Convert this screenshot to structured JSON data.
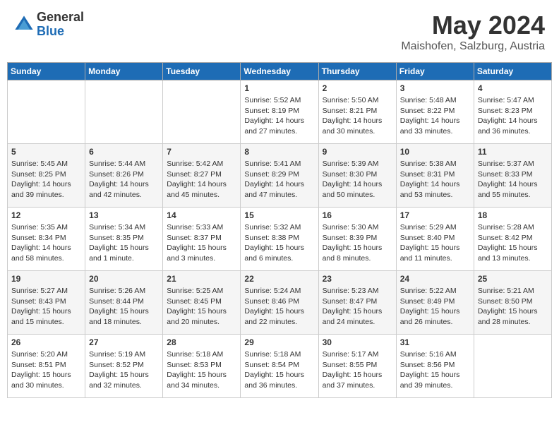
{
  "header": {
    "logo_general": "General",
    "logo_blue": "Blue",
    "month_title": "May 2024",
    "subtitle": "Maishofen, Salzburg, Austria"
  },
  "weekdays": [
    "Sunday",
    "Monday",
    "Tuesday",
    "Wednesday",
    "Thursday",
    "Friday",
    "Saturday"
  ],
  "weeks": [
    [
      {
        "day": "",
        "sunrise": "",
        "sunset": "",
        "daylight": ""
      },
      {
        "day": "",
        "sunrise": "",
        "sunset": "",
        "daylight": ""
      },
      {
        "day": "",
        "sunrise": "",
        "sunset": "",
        "daylight": ""
      },
      {
        "day": "1",
        "sunrise": "Sunrise: 5:52 AM",
        "sunset": "Sunset: 8:19 PM",
        "daylight": "Daylight: 14 hours and 27 minutes."
      },
      {
        "day": "2",
        "sunrise": "Sunrise: 5:50 AM",
        "sunset": "Sunset: 8:21 PM",
        "daylight": "Daylight: 14 hours and 30 minutes."
      },
      {
        "day": "3",
        "sunrise": "Sunrise: 5:48 AM",
        "sunset": "Sunset: 8:22 PM",
        "daylight": "Daylight: 14 hours and 33 minutes."
      },
      {
        "day": "4",
        "sunrise": "Sunrise: 5:47 AM",
        "sunset": "Sunset: 8:23 PM",
        "daylight": "Daylight: 14 hours and 36 minutes."
      }
    ],
    [
      {
        "day": "5",
        "sunrise": "Sunrise: 5:45 AM",
        "sunset": "Sunset: 8:25 PM",
        "daylight": "Daylight: 14 hours and 39 minutes."
      },
      {
        "day": "6",
        "sunrise": "Sunrise: 5:44 AM",
        "sunset": "Sunset: 8:26 PM",
        "daylight": "Daylight: 14 hours and 42 minutes."
      },
      {
        "day": "7",
        "sunrise": "Sunrise: 5:42 AM",
        "sunset": "Sunset: 8:27 PM",
        "daylight": "Daylight: 14 hours and 45 minutes."
      },
      {
        "day": "8",
        "sunrise": "Sunrise: 5:41 AM",
        "sunset": "Sunset: 8:29 PM",
        "daylight": "Daylight: 14 hours and 47 minutes."
      },
      {
        "day": "9",
        "sunrise": "Sunrise: 5:39 AM",
        "sunset": "Sunset: 8:30 PM",
        "daylight": "Daylight: 14 hours and 50 minutes."
      },
      {
        "day": "10",
        "sunrise": "Sunrise: 5:38 AM",
        "sunset": "Sunset: 8:31 PM",
        "daylight": "Daylight: 14 hours and 53 minutes."
      },
      {
        "day": "11",
        "sunrise": "Sunrise: 5:37 AM",
        "sunset": "Sunset: 8:33 PM",
        "daylight": "Daylight: 14 hours and 55 minutes."
      }
    ],
    [
      {
        "day": "12",
        "sunrise": "Sunrise: 5:35 AM",
        "sunset": "Sunset: 8:34 PM",
        "daylight": "Daylight: 14 hours and 58 minutes."
      },
      {
        "day": "13",
        "sunrise": "Sunrise: 5:34 AM",
        "sunset": "Sunset: 8:35 PM",
        "daylight": "Daylight: 15 hours and 1 minute."
      },
      {
        "day": "14",
        "sunrise": "Sunrise: 5:33 AM",
        "sunset": "Sunset: 8:37 PM",
        "daylight": "Daylight: 15 hours and 3 minutes."
      },
      {
        "day": "15",
        "sunrise": "Sunrise: 5:32 AM",
        "sunset": "Sunset: 8:38 PM",
        "daylight": "Daylight: 15 hours and 6 minutes."
      },
      {
        "day": "16",
        "sunrise": "Sunrise: 5:30 AM",
        "sunset": "Sunset: 8:39 PM",
        "daylight": "Daylight: 15 hours and 8 minutes."
      },
      {
        "day": "17",
        "sunrise": "Sunrise: 5:29 AM",
        "sunset": "Sunset: 8:40 PM",
        "daylight": "Daylight: 15 hours and 11 minutes."
      },
      {
        "day": "18",
        "sunrise": "Sunrise: 5:28 AM",
        "sunset": "Sunset: 8:42 PM",
        "daylight": "Daylight: 15 hours and 13 minutes."
      }
    ],
    [
      {
        "day": "19",
        "sunrise": "Sunrise: 5:27 AM",
        "sunset": "Sunset: 8:43 PM",
        "daylight": "Daylight: 15 hours and 15 minutes."
      },
      {
        "day": "20",
        "sunrise": "Sunrise: 5:26 AM",
        "sunset": "Sunset: 8:44 PM",
        "daylight": "Daylight: 15 hours and 18 minutes."
      },
      {
        "day": "21",
        "sunrise": "Sunrise: 5:25 AM",
        "sunset": "Sunset: 8:45 PM",
        "daylight": "Daylight: 15 hours and 20 minutes."
      },
      {
        "day": "22",
        "sunrise": "Sunrise: 5:24 AM",
        "sunset": "Sunset: 8:46 PM",
        "daylight": "Daylight: 15 hours and 22 minutes."
      },
      {
        "day": "23",
        "sunrise": "Sunrise: 5:23 AM",
        "sunset": "Sunset: 8:47 PM",
        "daylight": "Daylight: 15 hours and 24 minutes."
      },
      {
        "day": "24",
        "sunrise": "Sunrise: 5:22 AM",
        "sunset": "Sunset: 8:49 PM",
        "daylight": "Daylight: 15 hours and 26 minutes."
      },
      {
        "day": "25",
        "sunrise": "Sunrise: 5:21 AM",
        "sunset": "Sunset: 8:50 PM",
        "daylight": "Daylight: 15 hours and 28 minutes."
      }
    ],
    [
      {
        "day": "26",
        "sunrise": "Sunrise: 5:20 AM",
        "sunset": "Sunset: 8:51 PM",
        "daylight": "Daylight: 15 hours and 30 minutes."
      },
      {
        "day": "27",
        "sunrise": "Sunrise: 5:19 AM",
        "sunset": "Sunset: 8:52 PM",
        "daylight": "Daylight: 15 hours and 32 minutes."
      },
      {
        "day": "28",
        "sunrise": "Sunrise: 5:18 AM",
        "sunset": "Sunset: 8:53 PM",
        "daylight": "Daylight: 15 hours and 34 minutes."
      },
      {
        "day": "29",
        "sunrise": "Sunrise: 5:18 AM",
        "sunset": "Sunset: 8:54 PM",
        "daylight": "Daylight: 15 hours and 36 minutes."
      },
      {
        "day": "30",
        "sunrise": "Sunrise: 5:17 AM",
        "sunset": "Sunset: 8:55 PM",
        "daylight": "Daylight: 15 hours and 37 minutes."
      },
      {
        "day": "31",
        "sunrise": "Sunrise: 5:16 AM",
        "sunset": "Sunset: 8:56 PM",
        "daylight": "Daylight: 15 hours and 39 minutes."
      },
      {
        "day": "",
        "sunrise": "",
        "sunset": "",
        "daylight": ""
      }
    ]
  ]
}
